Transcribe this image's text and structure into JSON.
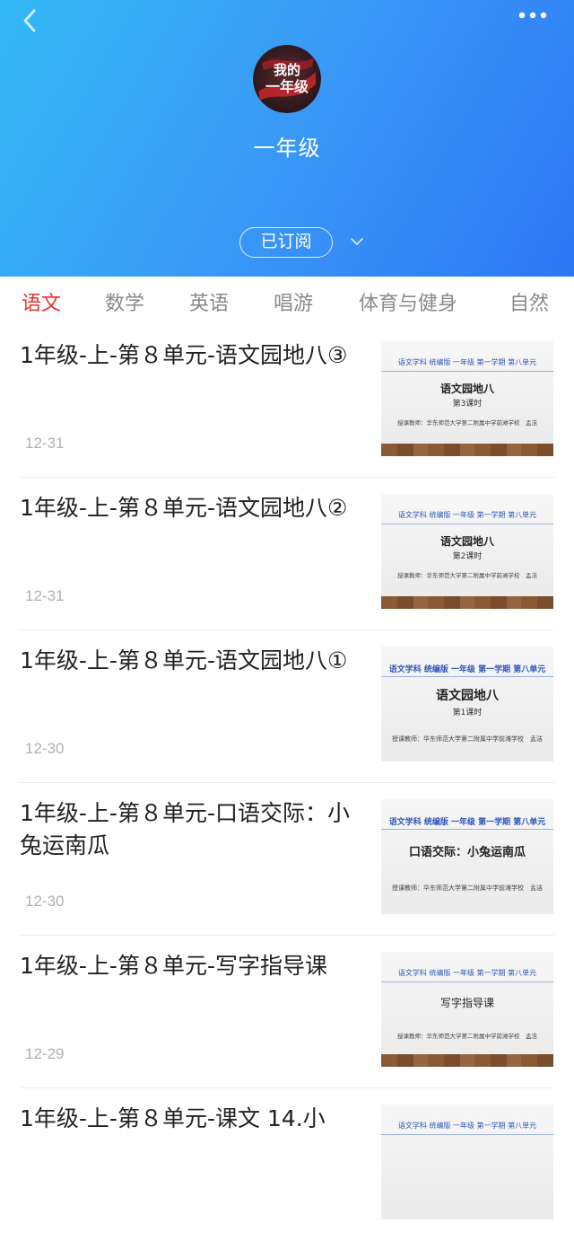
{
  "header": {
    "channel_title": "一年级",
    "avatar_text_line1": "我的",
    "avatar_text_line2": "一年级",
    "subscribe_label": "已订阅",
    "gradient_colors": [
      "#33b8f5",
      "#2e76f5"
    ]
  },
  "tabs": [
    {
      "label": "语文",
      "active": true
    },
    {
      "label": "数学",
      "active": false
    },
    {
      "label": "英语",
      "active": false
    },
    {
      "label": "唱游",
      "active": false
    },
    {
      "label": "体育与健身",
      "active": false
    },
    {
      "label": "自然",
      "active": false
    }
  ],
  "accent_color": "#e8342b",
  "items": [
    {
      "title": "1年级-上-第８单元-语文园地八③",
      "date": "12-31",
      "thumb": {
        "header": "语文学科  统编版  一年级  第一学期  第八单元",
        "title": "语文园地八",
        "lesson": "第3课时",
        "teacher": "授课教师：华东师范大学第二附属中学前滩学校　孟洁"
      }
    },
    {
      "title": "1年级-上-第８单元-语文园地八②",
      "date": "12-31",
      "thumb": {
        "header": "语文学科  统编版  一年级  第一学期  第八单元",
        "title": "语文园地八",
        "lesson": "第2课时",
        "teacher": "授课教师：华东师范大学第二附属中学前滩学校　孟洁"
      }
    },
    {
      "title": "1年级-上-第８单元-语文园地八①",
      "date": "12-30",
      "thumb": {
        "header": "语文学科  统编版  一年级  第一学期  第八单元",
        "title": "语文园地八",
        "lesson": "第1课时",
        "teacher": "授课教师：华东师范大学第二附属中学前滩学校　孟洁"
      }
    },
    {
      "title": "1年级-上-第８单元-口语交际：小兔运南瓜",
      "date": "12-30",
      "thumb": {
        "header": "语文学科  统编版  一年级  第一学期  第八单元",
        "title": "口语交际：小兔运南瓜",
        "lesson": "",
        "teacher": "授课教师：华东师范大学第二附属中学前滩学校　孟洁"
      }
    },
    {
      "title": "1年级-上-第８单元-写字指导课",
      "date": "12-29",
      "thumb": {
        "header": "语文学科  统编版  一年级  第一学期  第八单元",
        "title": "写字指导课",
        "lesson": "",
        "teacher": "授课教师：华东师范大学第二附属中学前滩学校　孟洁"
      }
    },
    {
      "title": "1年级-上-第８单元-课文 14.小",
      "date": "",
      "thumb": {
        "header": "语文学科  统编版  一年级  第一学期  第八单元",
        "title": "",
        "lesson": "",
        "teacher": ""
      }
    }
  ]
}
